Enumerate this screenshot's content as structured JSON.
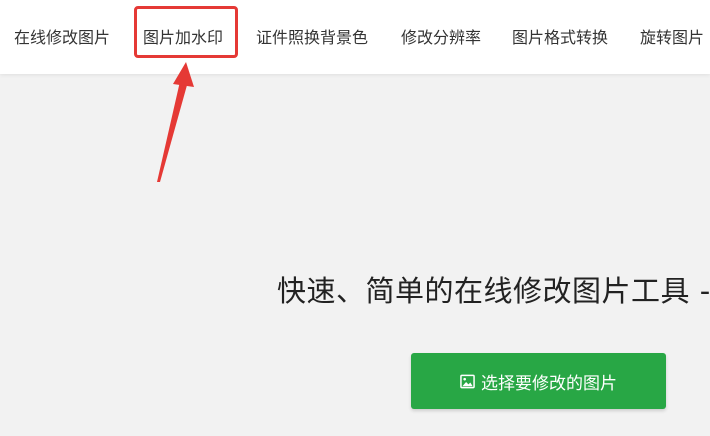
{
  "nav": {
    "items": [
      {
        "label": "在线修改图片"
      },
      {
        "label": "图片加水印"
      },
      {
        "label": "证件照换背景色"
      },
      {
        "label": "修改分辨率"
      },
      {
        "label": "图片格式转换"
      },
      {
        "label": "旋转图片"
      }
    ]
  },
  "hero": {
    "tagline": "快速、简单的在线修改图片工具 -",
    "button_label": "选择要修改的图片",
    "button_icon": "image-icon"
  },
  "colors": {
    "highlight": "#e53935",
    "button": "#28a745",
    "background": "#f2f2f2"
  }
}
